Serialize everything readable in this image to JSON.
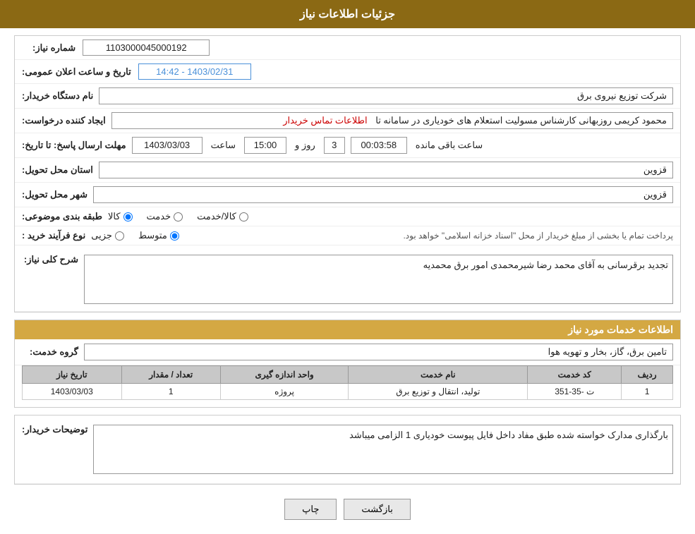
{
  "header": {
    "title": "جزئیات اطلاعات نیاز"
  },
  "form": {
    "need_number_label": "شماره نیاز:",
    "need_number_value": "1103000045000192",
    "announcement_date_label": "تاریخ و ساعت اعلان عمومی:",
    "announcement_date_value": "1403/02/31 - 14:42",
    "requester_name_label": "نام دستگاه خریدار:",
    "requester_name_value": "شرکت توزیع نیروی برق",
    "creator_label": "ایجاد کننده درخواست:",
    "creator_value": "محمود کریمی روزبهانی کارشناس  مسولیت استعلام های خودیاری در سامانه تا",
    "creator_link": "اطلاعات تماس خریدار",
    "deadline_label": "مهلت ارسال پاسخ: تا تاریخ:",
    "deadline_date": "1403/03/03",
    "deadline_time_label": "ساعت",
    "deadline_time": "15:00",
    "deadline_days_label": "روز و",
    "deadline_days": "3",
    "deadline_remaining_label": "ساعت باقی مانده",
    "deadline_remaining": "00:03:58",
    "province_label": "استان محل تحویل:",
    "province_value": "قزوین",
    "city_label": "شهر محل تحویل:",
    "city_value": "قزوین",
    "category_label": "طبقه بندی موضوعی:",
    "category_options": [
      {
        "label": "کالا",
        "value": "kala"
      },
      {
        "label": "خدمت",
        "value": "khadamat"
      },
      {
        "label": "کالا/خدمت",
        "value": "kala_khadamat"
      }
    ],
    "category_selected": "kala",
    "purchase_type_label": "نوع فرآیند خرید :",
    "purchase_type_options": [
      {
        "label": "جزیی",
        "value": "jozi"
      },
      {
        "label": "متوسط",
        "value": "motavaset"
      }
    ],
    "purchase_type_selected": "motavaset",
    "purchase_type_note": "پرداخت تمام یا بخشی از مبلغ خریدار از محل \"اسناد خزانه اسلامی\" خواهد بود.",
    "general_description_label": "شرح کلی نیاز:",
    "general_description_value": "تجدید برقرسانی به آقای محمد رضا شیرمحمدی امور برق محمدیه",
    "services_section_title": "اطلاعات خدمات مورد نیاز",
    "service_group_label": "گروه خدمت:",
    "service_group_value": "تامین برق، گاز، بخار و تهویه هوا",
    "table": {
      "columns": [
        "ردیف",
        "کد خدمت",
        "نام خدمت",
        "واحد اندازه گیری",
        "تعداد / مقدار",
        "تاریخ نیاز"
      ],
      "rows": [
        {
          "row": "1",
          "code": "ت -35-351",
          "name": "تولید، انتقال و توزیع برق",
          "unit": "پروژه",
          "qty": "1",
          "date": "1403/03/03"
        }
      ]
    },
    "buyer_desc_label": "توضیحات خریدار:",
    "buyer_desc_value": "بارگذاری مدارک خواسته شده طبق مفاد داخل فایل پیوست خودیاری 1 الزامی میباشد",
    "btn_print": "چاپ",
    "btn_back": "بازگشت"
  }
}
